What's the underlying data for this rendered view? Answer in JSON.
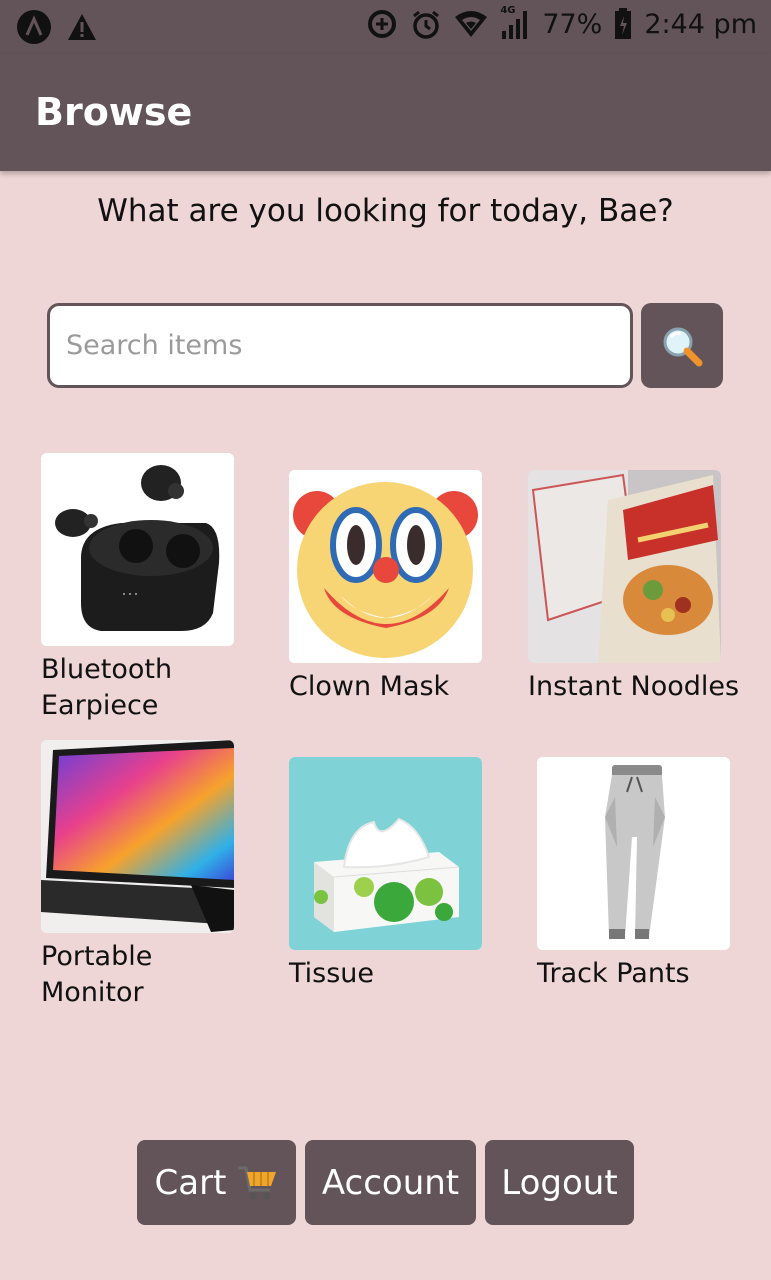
{
  "status_bar": {
    "network": "4G",
    "battery": "77%",
    "time": "2:44 pm"
  },
  "appbar": {
    "title": "Browse"
  },
  "greeting": "What are you looking for today, Bae?",
  "search": {
    "placeholder": "Search items",
    "value": ""
  },
  "items": [
    {
      "label": "Bluetooth Earpiece",
      "icon": "earbuds-image"
    },
    {
      "label": "Clown Mask",
      "icon": "clown-face-image"
    },
    {
      "label": "Instant Noodles",
      "icon": "noodles-image"
    },
    {
      "label": "Portable Monitor",
      "icon": "monitor-image"
    },
    {
      "label": "Tissue",
      "icon": "tissue-box-image"
    },
    {
      "label": "Track Pants",
      "icon": "track-pants-image"
    }
  ],
  "bottom_nav": {
    "cart_label": "Cart",
    "account_label": "Account",
    "logout_label": "Logout"
  },
  "colors": {
    "primary": "#625459",
    "background": "#efd6d6"
  }
}
